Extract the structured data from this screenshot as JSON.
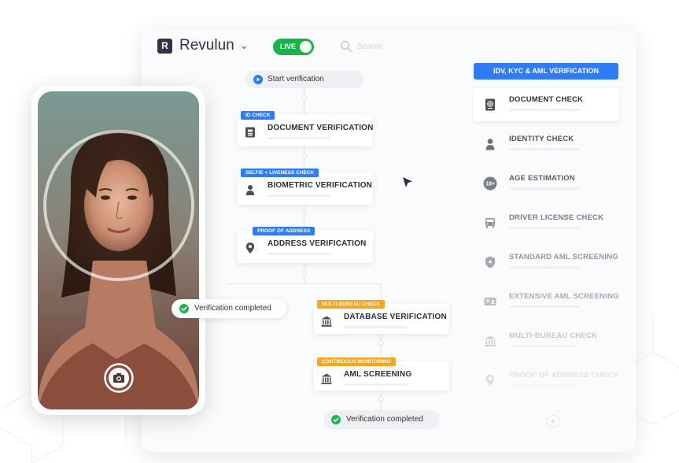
{
  "app": {
    "logo_letter": "R",
    "brand_name": "Revulun",
    "live_label": "LIVE",
    "search_placeholder": "Search"
  },
  "colors": {
    "accent_blue": "#2f7cf6",
    "accent_orange": "#f5a623",
    "live_green": "#19b34a",
    "success_green": "#1fb355"
  },
  "flow": {
    "start_label": "Start verification",
    "steps": [
      {
        "tag": "ID CHECK",
        "title": "DOCUMENT VERIFICATION",
        "icon": "id-card-icon"
      },
      {
        "tag": "SELFIE + LIVENESS CHECK",
        "title": "BIOMETRIC VERIFICATION",
        "icon": "person-icon"
      },
      {
        "tag": "PROOF OF ADDRESS",
        "title": "ADDRESS VERIFICATION",
        "icon": "location-pin-icon"
      },
      {
        "tag": "MULTI-BUREAU CHECK",
        "title": "DATABASE VERIFICATION",
        "icon": "bank-icon"
      },
      {
        "tag": "CONTINUOUS MONITORING",
        "title": "AML SCREENING",
        "icon": "bank-icon"
      }
    ],
    "completed_label": "Verification completed"
  },
  "phone": {
    "completed_label": "Verification completed",
    "camera_icon": "camera-icon"
  },
  "checks_panel": {
    "title": "IDV, KYC & AML VERIFICATION",
    "items": [
      {
        "label": "DOCUMENT CHECK",
        "icon": "passport-icon"
      },
      {
        "label": "IDENTITY CHECK",
        "icon": "person-icon"
      },
      {
        "label": "AGE ESTIMATION",
        "icon": "age-18-icon",
        "icon_text": "18+"
      },
      {
        "label": "DRIVER LICENSE CHECK",
        "icon": "car-icon"
      },
      {
        "label": "STANDARD AML SCREENING",
        "icon": "shield-icon"
      },
      {
        "label": "EXTENSIVE AML SCREENING",
        "icon": "id-card-icon"
      },
      {
        "label": "MULTI-BUREAU CHECK",
        "icon": "bank-icon"
      },
      {
        "label": "PROOF OF ADDRESS CHECK",
        "icon": "location-pin-icon"
      }
    ],
    "add_label": "+"
  }
}
